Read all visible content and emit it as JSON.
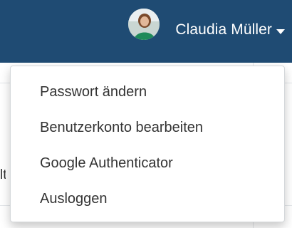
{
  "header": {
    "user_name": "Claudia Müller",
    "avatar_icon": "user-avatar-photo",
    "caret_icon": "caret-down-icon",
    "background_color": "#1f4b73"
  },
  "page": {
    "fragment_text": "lt"
  },
  "user_menu": {
    "items": [
      {
        "label": "Passwort ändern"
      },
      {
        "label": "Benutzerkonto bearbeiten"
      },
      {
        "label": "Google Authenticator"
      },
      {
        "label": "Ausloggen"
      }
    ]
  }
}
